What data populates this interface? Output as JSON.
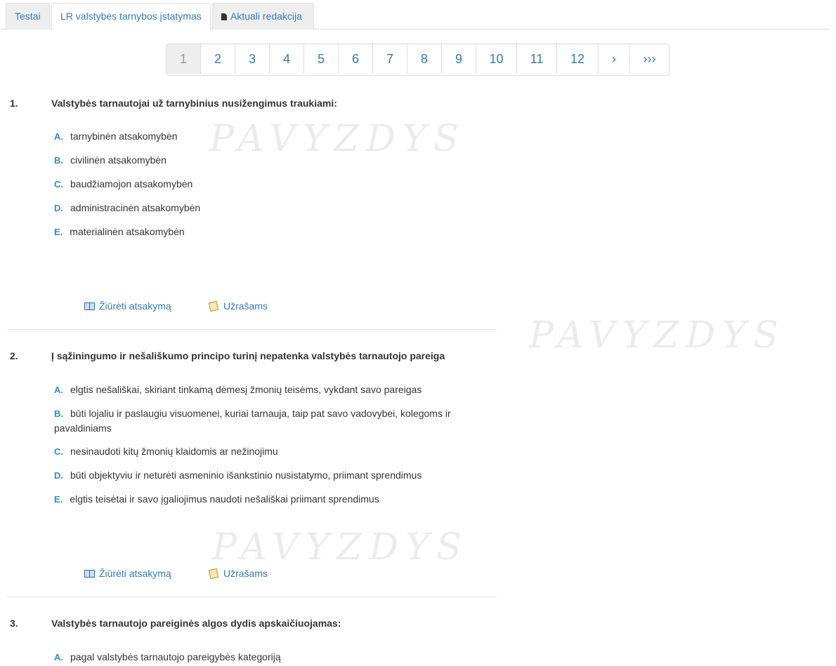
{
  "tabs": [
    {
      "label": "Testai"
    },
    {
      "label": "LR valstybės tarnybos įstatymas"
    },
    {
      "label": "Aktuali redakcija",
      "icon": "document-icon"
    }
  ],
  "pagination": {
    "pages": [
      "1",
      "2",
      "3",
      "4",
      "5",
      "6",
      "7",
      "8",
      "9",
      "10",
      "11",
      "12"
    ],
    "next": "›",
    "last": "›››",
    "current": "1"
  },
  "watermark": "PAVYZDYS",
  "actions": {
    "view_answer": "Žiūrėti atsakymą",
    "notes": "Užrašams"
  },
  "questions": [
    {
      "num": "1.",
      "text": "Valstybės tarnautojai už tarnybinius nusižengimus traukiami:",
      "options": [
        {
          "letter": "A.",
          "text": "tarnybinėn atsakomybėn"
        },
        {
          "letter": "B.",
          "text": "civilinėn atsakomybėn"
        },
        {
          "letter": "C.",
          "text": "baudžiamojon atsakomybėn"
        },
        {
          "letter": "D.",
          "text": "administracinėn atsakomybėn"
        },
        {
          "letter": "E.",
          "text": "materialinėn atsakomybėn"
        }
      ]
    },
    {
      "num": "2.",
      "text": "Į sąžiningumo ir nešališkumo principo turinį nepatenka valstybės tarnautojo pareiga",
      "options": [
        {
          "letter": "A.",
          "text": "elgtis nešališkai, skiriant tinkamą dėmesį žmonių teisėms, vykdant savo pareigas"
        },
        {
          "letter": "B.",
          "text": "būti lojaliu ir paslaugiu visuomenei, kuriai tarnauja, taip pat savo vadovybei, kolegoms ir pavaldiniams"
        },
        {
          "letter": "C.",
          "text": "nesinaudoti kitų žmonių klaidomis ar nežinojimu"
        },
        {
          "letter": "D.",
          "text": "būti objektyviu ir neturėti asmeninio išankstinio nusistatymo, priimant sprendimus"
        },
        {
          "letter": "E.",
          "text": "elgtis teisėtai ir savo įgaliojimus naudoti nešališkai priimant sprendimus"
        }
      ]
    },
    {
      "num": "3.",
      "text": "Valstybės tarnautojo pareiginės algos dydis apskaičiuojamas:",
      "options": [
        {
          "letter": "A.",
          "text": "pagal valstybės tarnautojo pareigybės kategoriją"
        }
      ]
    }
  ]
}
